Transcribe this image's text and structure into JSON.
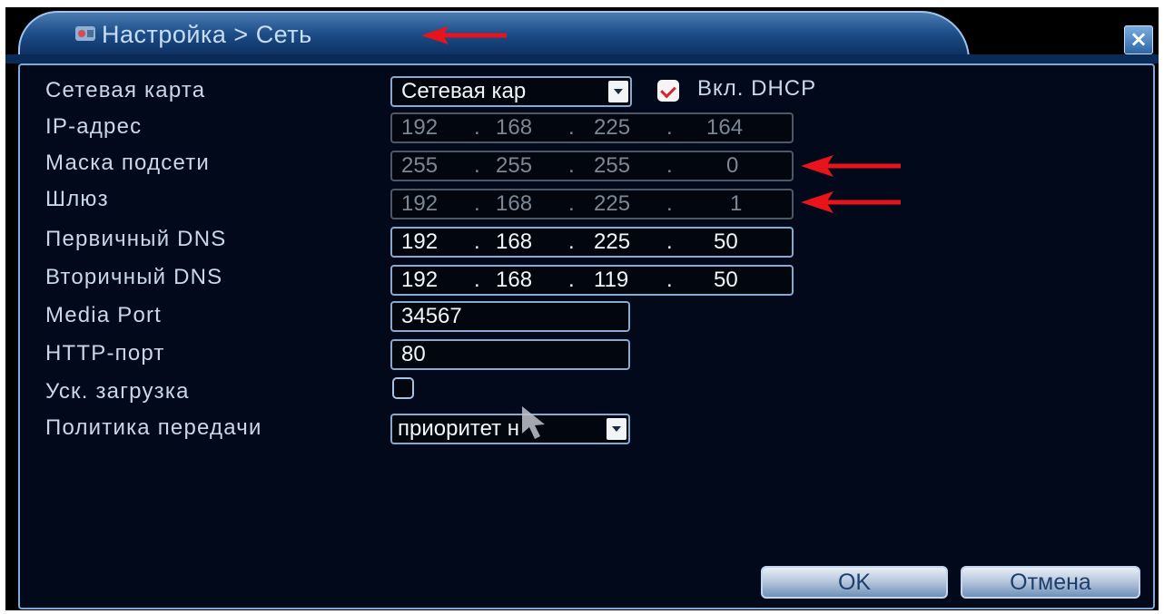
{
  "window": {
    "title": "Настройка > Сеть",
    "close_label": "×"
  },
  "form": {
    "network_card": {
      "label": "Сетевая карта",
      "value": "Сетевая кар"
    },
    "dhcp": {
      "label": "Вкл. DHCP",
      "checked": true
    },
    "ip_address": {
      "label": "IP-адрес",
      "octets": [
        "192",
        "168",
        "225",
        "164"
      ]
    },
    "subnet_mask": {
      "label": "Маска подсети",
      "octets": [
        "255",
        "255",
        "255",
        "0"
      ]
    },
    "gateway": {
      "label": "Шлюз",
      "octets": [
        "192",
        "168",
        "225",
        "1"
      ]
    },
    "primary_dns": {
      "label": "Первичный DNS",
      "octets": [
        "192",
        "168",
        "225",
        "50"
      ]
    },
    "secondary_dns": {
      "label": "Вторичный DNS",
      "octets": [
        "192",
        "168",
        "119",
        "50"
      ]
    },
    "media_port": {
      "label": "Media Port",
      "value": "34567"
    },
    "http_port": {
      "label": "HTTP-порт",
      "value": "80"
    },
    "fast_download": {
      "label": "Уск. загрузка",
      "checked": false
    },
    "transfer_policy": {
      "label": "Политика передачи",
      "value": "приоритет н"
    }
  },
  "buttons": {
    "ok": "OK",
    "cancel": "Отмена"
  },
  "colors": {
    "annotation_arrow": "#e8141c",
    "panel_border": "#7fa9d9",
    "title_bar": "#1d4d88"
  }
}
